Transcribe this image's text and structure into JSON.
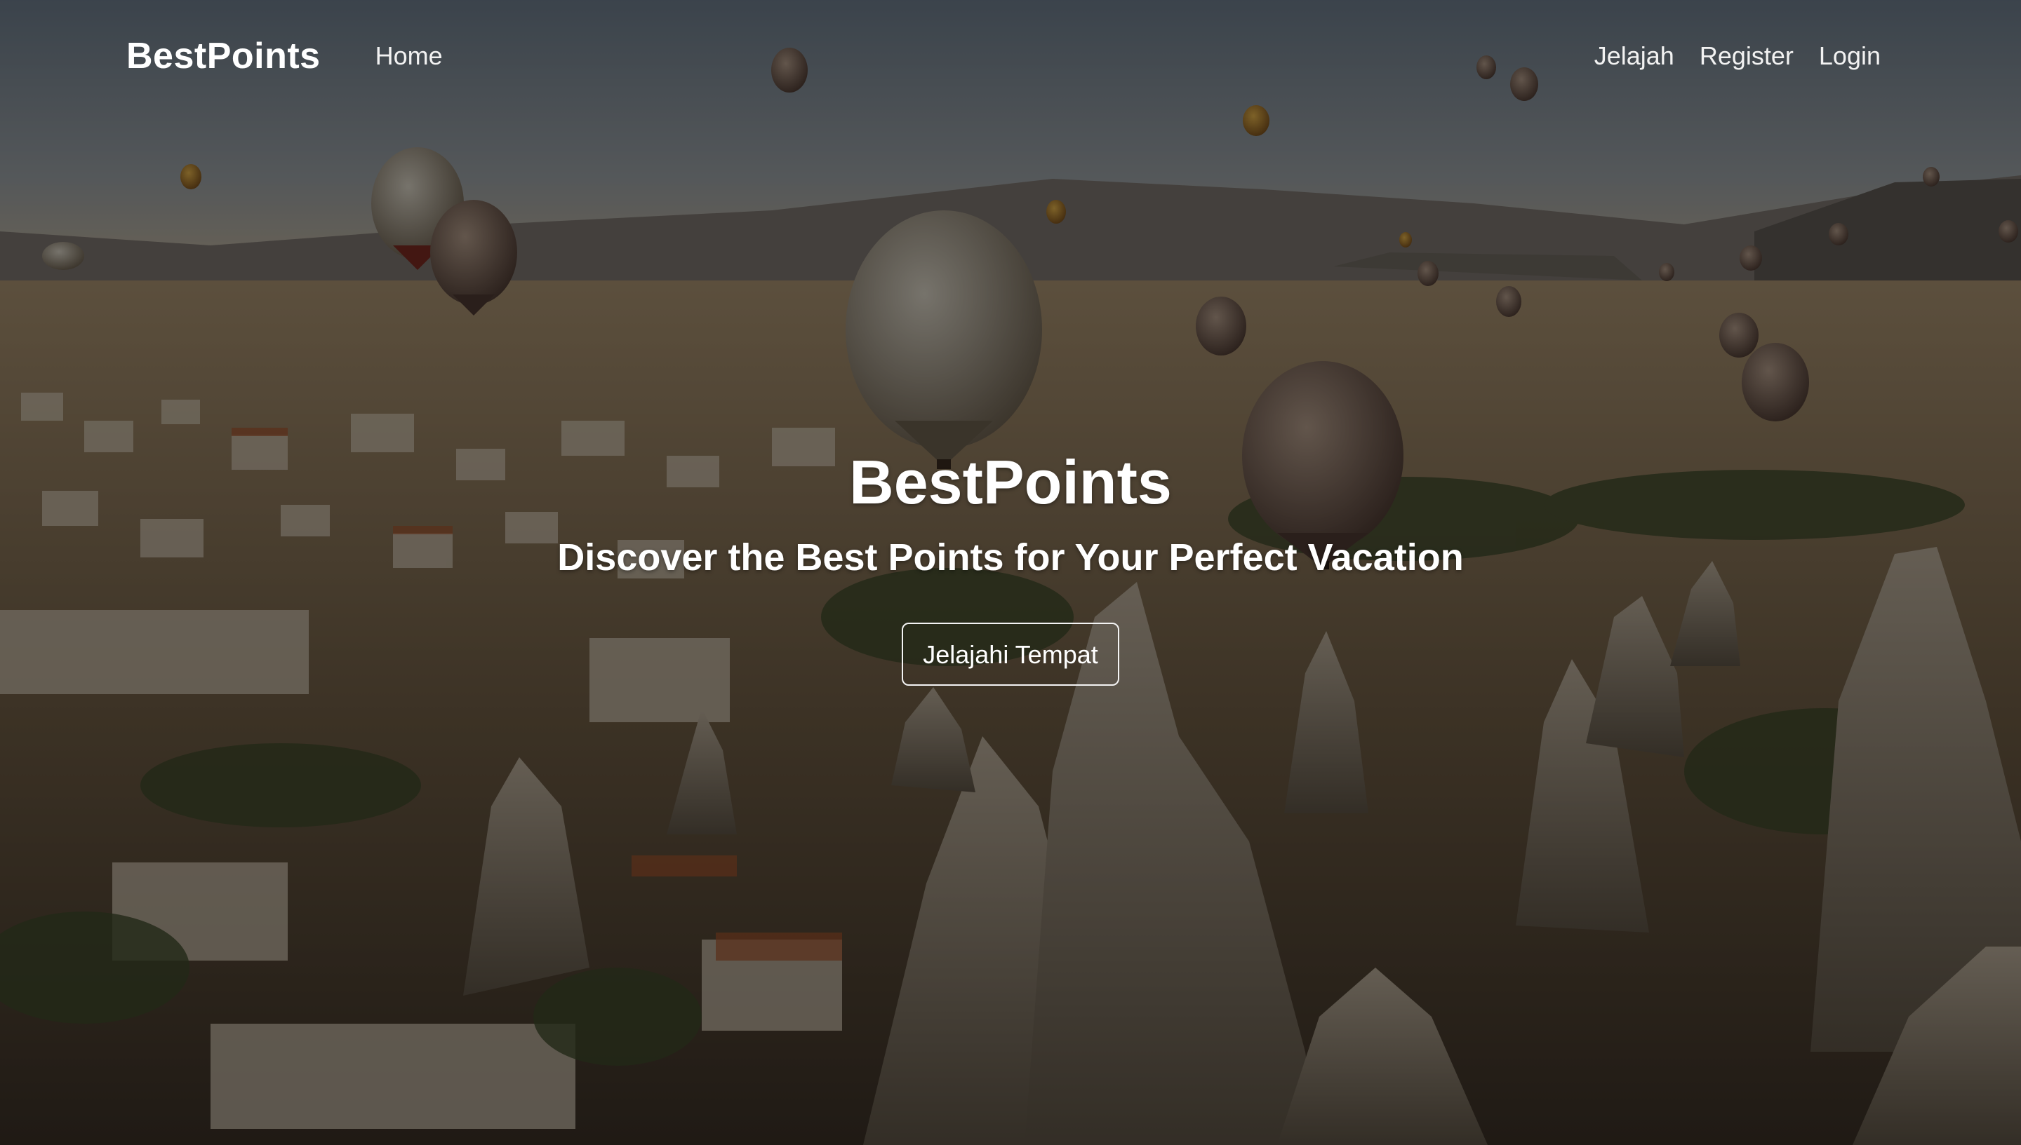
{
  "navbar": {
    "brand": "BestPoints",
    "left_links": [
      "Home"
    ],
    "right_links": [
      "Jelajah",
      "Register",
      "Login"
    ]
  },
  "hero": {
    "title": "BestPoints",
    "subtitle": "Discover the Best Points for Your Perfect Vacation",
    "button_label": "Jelajahi Tempat"
  },
  "colors": {
    "text": "#ffffff",
    "overlay": "rgba(0,0,0,0.45)"
  }
}
